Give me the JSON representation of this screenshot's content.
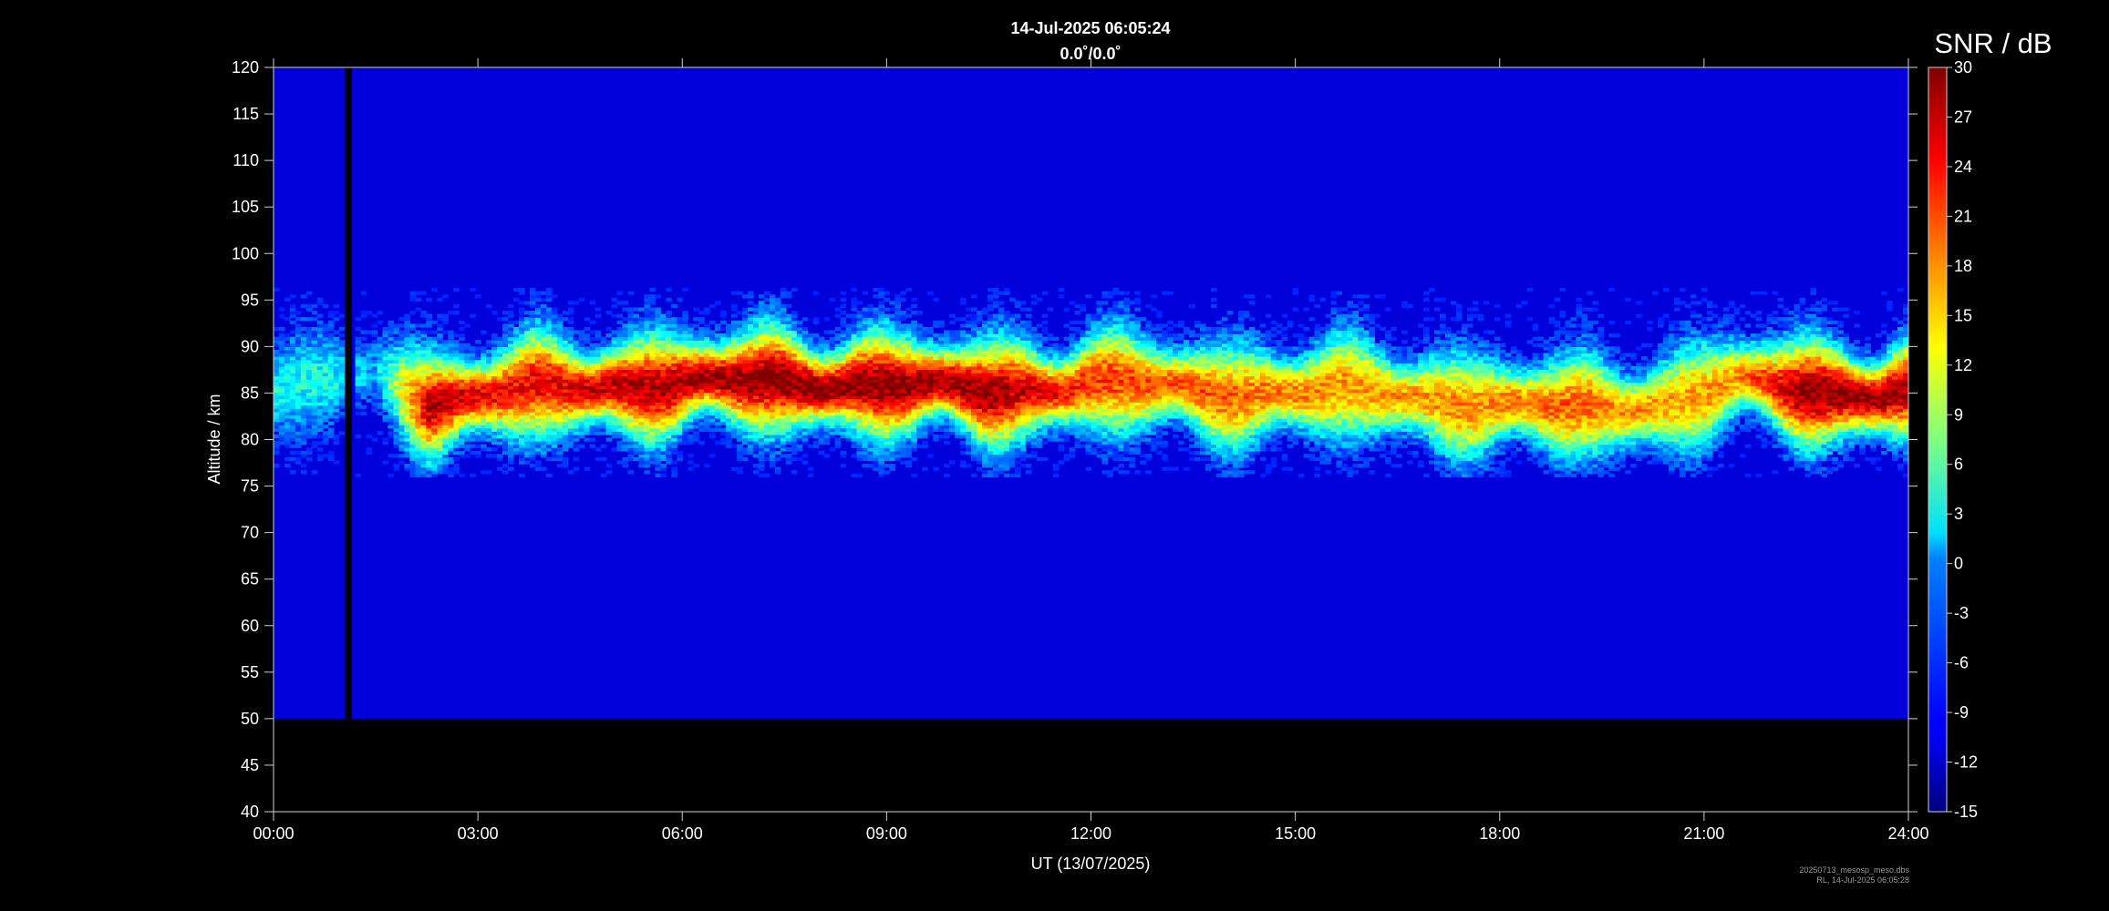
{
  "chart_data": {
    "type": "heatmap",
    "title": "14-Jul-2025 06:05:24",
    "subtitle": "0.0˚/0.0˚",
    "xlabel": "UT (13/07/2025)",
    "ylabel": "Altitude / km",
    "x_ticks": [
      "00:00",
      "03:00",
      "06:00",
      "09:00",
      "12:00",
      "15:00",
      "18:00",
      "21:00",
      "24:00"
    ],
    "xlim_hours": [
      0,
      24
    ],
    "y_ticks": [
      40,
      45,
      50,
      55,
      60,
      65,
      70,
      75,
      80,
      85,
      90,
      95,
      100,
      105,
      110,
      115,
      120
    ],
    "ylim": [
      40,
      120
    ],
    "data_altitude_range": [
      50,
      120
    ],
    "data_gap_hours": [
      1.05,
      1.15
    ],
    "colorbar": {
      "label": "SNR / dB",
      "range": [
        -15,
        30
      ],
      "ticks": [
        30,
        27,
        24,
        21,
        18,
        15,
        12,
        9,
        6,
        3,
        0,
        -3,
        -6,
        -9,
        -12,
        -15
      ],
      "colormap": "jet"
    },
    "background_snr_db": -11,
    "echo_layer": {
      "description_points": [
        {
          "hour": 0.2,
          "altitude": 85,
          "peak_snr": 2
        },
        {
          "hour": 0.7,
          "altitude": 86,
          "peak_snr": 3
        },
        {
          "hour": 1.5,
          "altitude": 87,
          "peak_snr": -2
        },
        {
          "hour": 2.3,
          "altitude": 84,
          "peak_snr": 28
        },
        {
          "hour": 3.5,
          "altitude": 85,
          "peak_snr": 24
        },
        {
          "hour": 5.5,
          "altitude": 86,
          "peak_snr": 28
        },
        {
          "hour": 7.5,
          "altitude": 86,
          "peak_snr": 30
        },
        {
          "hour": 8.5,
          "altitude": 86,
          "peak_snr": 30
        },
        {
          "hour": 10.5,
          "altitude": 85,
          "peak_snr": 29
        },
        {
          "hour": 12.0,
          "altitude": 86,
          "peak_snr": 22
        },
        {
          "hour": 14.0,
          "altitude": 85,
          "peak_snr": 20
        },
        {
          "hour": 16.0,
          "altitude": 85,
          "peak_snr": 18
        },
        {
          "hour": 17.5,
          "altitude": 84,
          "peak_snr": 18
        },
        {
          "hour": 19.0,
          "altitude": 83,
          "peak_snr": 20
        },
        {
          "hour": 20.5,
          "altitude": 84,
          "peak_snr": 17
        },
        {
          "hour": 21.5,
          "altitude": 86,
          "peak_snr": 18
        },
        {
          "hour": 22.5,
          "altitude": 85,
          "peak_snr": 30
        },
        {
          "hour": 24.0,
          "altitude": 85,
          "peak_snr": 29
        }
      ]
    },
    "footer_lines": [
      "20250713_mesosp_meso.dbs",
      "RL, 14-Jul-2025 06:05:28"
    ]
  },
  "colors": {
    "background": "#000000",
    "axis": "#cfcfcf",
    "text": "#ffffff",
    "no_data": "#000000"
  }
}
